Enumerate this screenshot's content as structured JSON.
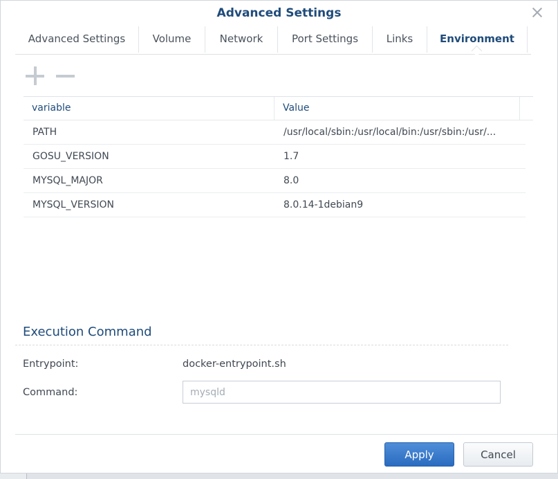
{
  "dialog": {
    "title": "Advanced Settings"
  },
  "tabs": [
    {
      "label": "Advanced Settings"
    },
    {
      "label": "Volume"
    },
    {
      "label": "Network"
    },
    {
      "label": "Port Settings"
    },
    {
      "label": "Links"
    },
    {
      "label": "Environment",
      "active": true
    }
  ],
  "toolbar": {
    "add_icon": "plus-icon",
    "remove_icon": "minus-icon"
  },
  "env_table": {
    "headers": [
      "variable",
      "Value"
    ],
    "rows": [
      [
        "PATH",
        "/usr/local/sbin:/usr/local/bin:/usr/sbin:/usr/..."
      ],
      [
        "GOSU_VERSION",
        "1.7"
      ],
      [
        "MYSQL_MAJOR",
        "8.0"
      ],
      [
        "MYSQL_VERSION",
        "8.0.14-1debian9"
      ]
    ]
  },
  "execution": {
    "title": "Execution Command",
    "entrypoint_label": "Entrypoint:",
    "entrypoint_value": "docker-entrypoint.sh",
    "command_label": "Command:",
    "command_placeholder": "mysqld"
  },
  "footer": {
    "apply_label": "Apply",
    "cancel_label": "Cancel"
  },
  "colors": {
    "accent": "#1f4b7a",
    "primary_button": "#2a6bc0"
  }
}
